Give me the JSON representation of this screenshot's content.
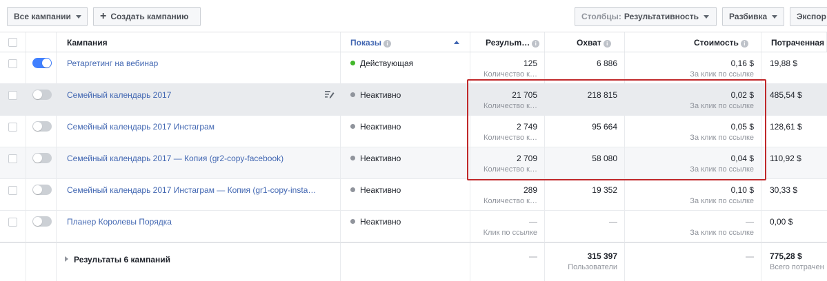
{
  "toolbar": {
    "all_campaigns": "Все кампании",
    "create_campaign": "Создать кампанию",
    "columns_prefix": "Столбцы:",
    "columns_value": "Результативность",
    "breakdown": "Разбивка",
    "export": "Экспор"
  },
  "columns": {
    "campaign": "Кампания",
    "delivery": "Показы",
    "results": "Резульm…",
    "reach": "Охват",
    "cost": "Стоимость",
    "spent": "Потраченная"
  },
  "rows": [
    {
      "name": "Ретаргетинг на вебинар",
      "toggle": "on",
      "status": "Действующая",
      "status_color": "#42b72a",
      "results": "125",
      "results_sub": "Количество к…",
      "reach": "6 886",
      "cost": "0,16 $",
      "cost_sub": "За клик по ссылке",
      "spent": "19,88 $"
    },
    {
      "name": "Семейный календарь 2017",
      "toggle": "off",
      "status": "Неактивно",
      "status_color": "#90949c",
      "results": "21 705",
      "results_sub": "Количество к…",
      "reach": "218 815",
      "cost": "0,02 $",
      "cost_sub": "За клик по ссылке",
      "spent": "485,54 $"
    },
    {
      "name": "Семейный календарь 2017 Инстаграм",
      "toggle": "off",
      "status": "Неактивно",
      "status_color": "#90949c",
      "results": "2 749",
      "results_sub": "Количество к…",
      "reach": "95 664",
      "cost": "0,05 $",
      "cost_sub": "За клик по ссылке",
      "spent": "128,61 $"
    },
    {
      "name": "Семейный календарь 2017 — Копия (gr2-copy-facebook)",
      "toggle": "off",
      "status": "Неактивно",
      "status_color": "#90949c",
      "results": "2 709",
      "results_sub": "Количество к…",
      "reach": "58 080",
      "cost": "0,04 $",
      "cost_sub": "За клик по ссылке",
      "spent": "110,92 $"
    },
    {
      "name": "Семейный календарь 2017 Инстаграм — Копия (gr1-copy-insta…",
      "toggle": "off",
      "status": "Неактивно",
      "status_color": "#90949c",
      "results": "289",
      "results_sub": "Количество к…",
      "reach": "19 352",
      "cost": "0,10 $",
      "cost_sub": "За клик по ссылке",
      "spent": "30,33 $"
    },
    {
      "name": "Планер Королевы Порядка",
      "toggle": "off",
      "status": "Неактивно",
      "status_color": "#90949c",
      "results": "—",
      "results_sub": "Клик по ссылке",
      "reach": "—",
      "cost": "—",
      "cost_sub": "За клик по ссылке",
      "spent": "0,00 $"
    }
  ],
  "totals": {
    "label": "Результаты 6 кампаний",
    "results": "—",
    "reach": "315 397",
    "reach_sub": "Пользователи",
    "cost": "—",
    "spent": "775,28 $",
    "spent_sub": "Всего потрачен"
  },
  "colors": {
    "link": "#4267b2",
    "toggle_on": "#4080ff",
    "highlight_border": "#c0282a",
    "selected_row": "#e9ebee"
  }
}
